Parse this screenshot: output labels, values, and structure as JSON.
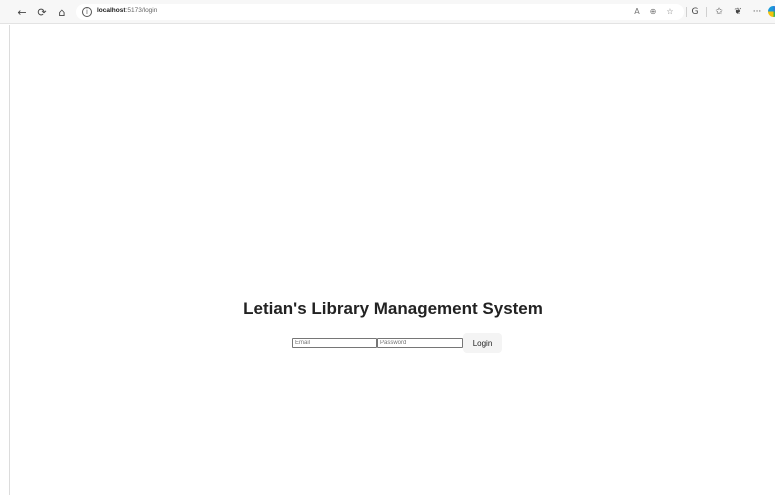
{
  "browser": {
    "back_icon": "←",
    "reload_icon": "⟳",
    "home_icon": "⌂",
    "url_host": "localhost",
    "url_path": ":5173/login",
    "read_aloud_icon": "A",
    "zoom_icon": "⊕",
    "favorite_icon": "☆",
    "collections_icon": "G",
    "favorites_bar_icon": "✩",
    "extensions_icon": "❦",
    "more_icon": "···"
  },
  "page": {
    "title": "Letian's Library Management System",
    "email_placeholder": "Email",
    "password_placeholder": "Password",
    "login_label": "Login"
  }
}
